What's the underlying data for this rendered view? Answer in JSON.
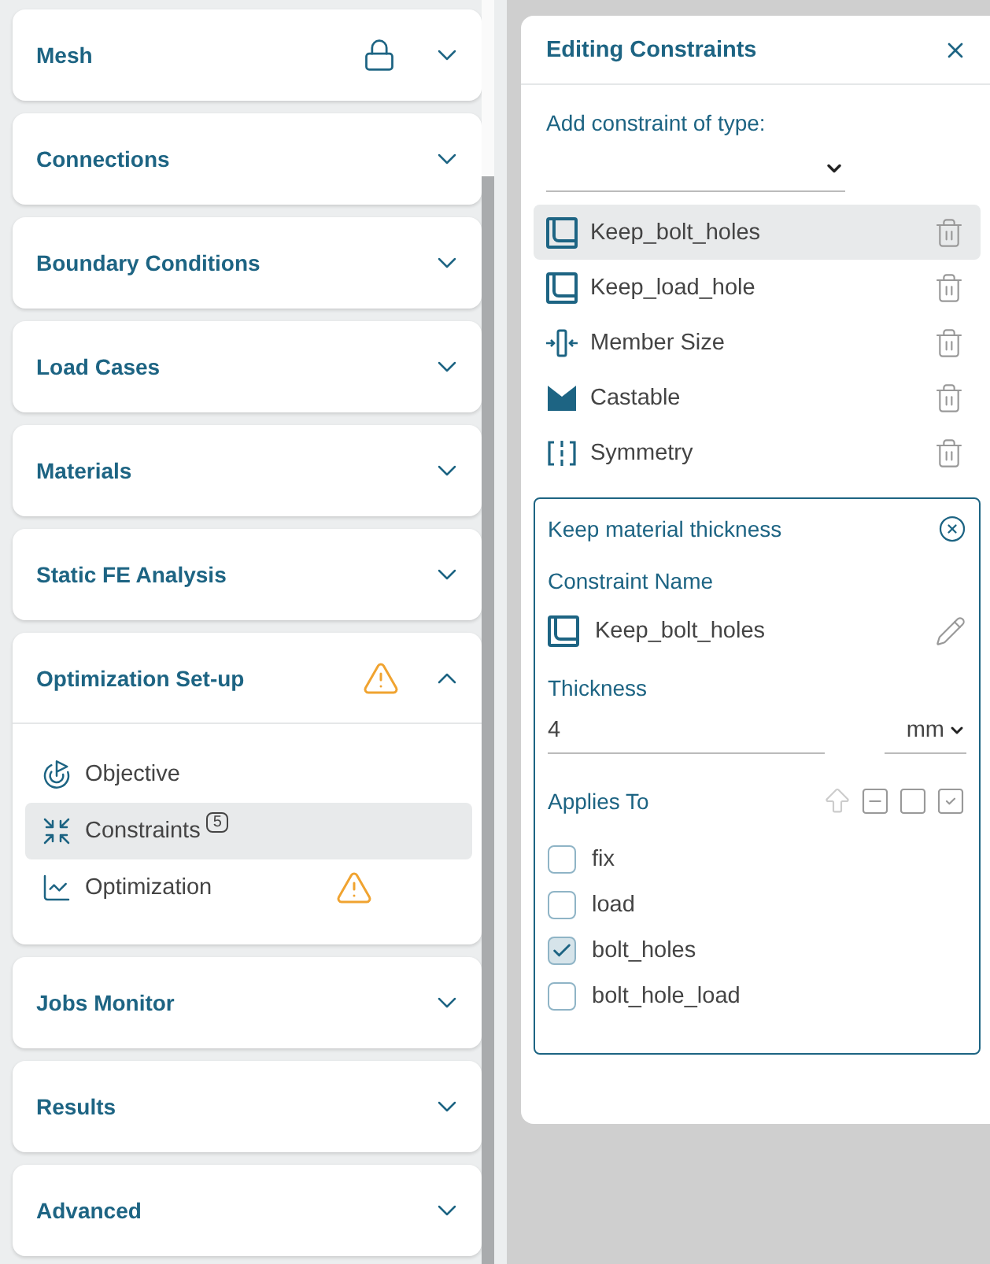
{
  "sections": [
    {
      "title": "Mesh",
      "expanded": false,
      "locked": true
    },
    {
      "title": "Connections",
      "expanded": false
    },
    {
      "title": "Boundary Conditions",
      "expanded": false
    },
    {
      "title": "Load Cases",
      "expanded": false
    },
    {
      "title": "Materials",
      "expanded": false
    },
    {
      "title": "Static FE Analysis",
      "expanded": false
    },
    {
      "title": "Optimization Set-up",
      "expanded": true,
      "warning": true,
      "items": [
        {
          "kind": "objective",
          "label": "Objective",
          "selected": false
        },
        {
          "kind": "constraints",
          "label": "Constraints",
          "badge": "5",
          "selected": true
        },
        {
          "kind": "optimization",
          "label": "Optimization",
          "selected": false,
          "warning": true
        }
      ]
    },
    {
      "title": "Jobs Monitor",
      "expanded": false
    },
    {
      "title": "Results",
      "expanded": false
    },
    {
      "title": "Advanced",
      "expanded": false
    }
  ],
  "editor": {
    "title": "Editing Constraints",
    "add_label": "Add constraint of type:",
    "constraints": [
      {
        "kind": "keep",
        "name": "Keep_bolt_holes",
        "selected": true
      },
      {
        "kind": "keep",
        "name": "Keep_load_hole",
        "selected": false
      },
      {
        "kind": "member",
        "name": "Member Size",
        "selected": false
      },
      {
        "kind": "castable",
        "name": "Castable",
        "selected": false
      },
      {
        "kind": "symmetry",
        "name": "Symmetry",
        "selected": false
      }
    ],
    "detail": {
      "title": "Keep material thickness",
      "name_label": "Constraint Name",
      "kind": "keep",
      "name": "Keep_bolt_holes",
      "thickness_label": "Thickness",
      "thickness": "4",
      "unit": "mm",
      "applies_label": "Applies To",
      "targets": [
        {
          "label": "fix",
          "checked": false
        },
        {
          "label": "load",
          "checked": false
        },
        {
          "label": "bolt_holes",
          "checked": true
        },
        {
          "label": "bolt_hole_load",
          "checked": false
        }
      ]
    }
  }
}
